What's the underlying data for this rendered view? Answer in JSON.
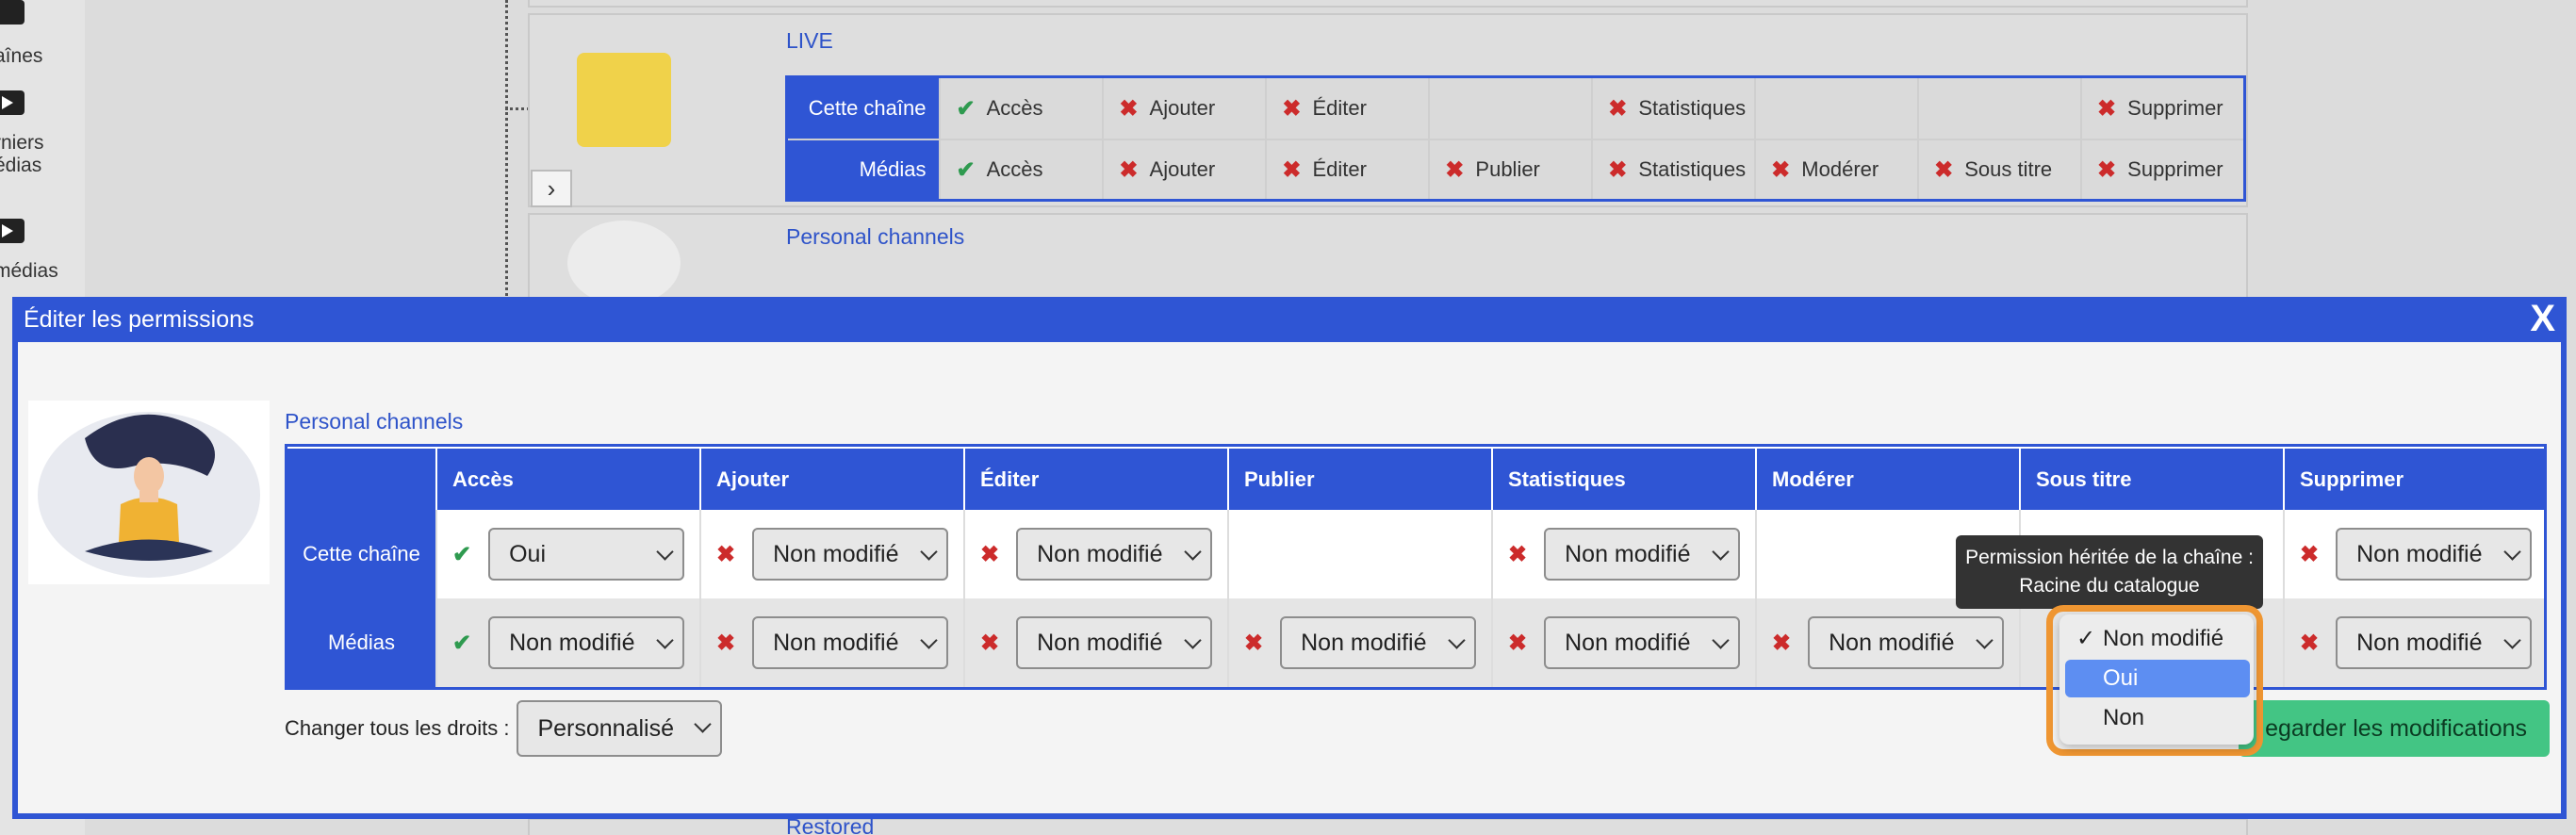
{
  "background": {
    "sidebar": [
      "aînes",
      "rniers\nédias",
      "médias"
    ],
    "rows": [
      {
        "name": "LIVE",
        "permissions": [
          {
            "label": "Cette chaîne",
            "cells": [
              {
                "mark": "check",
                "text": "Accès"
              },
              {
                "mark": "x",
                "text": "Ajouter"
              },
              {
                "mark": "x",
                "text": "Éditer"
              },
              {
                "mark": "",
                "text": ""
              },
              {
                "mark": "x",
                "text": "Statistiques"
              },
              {
                "mark": "",
                "text": ""
              },
              {
                "mark": "",
                "text": ""
              },
              {
                "mark": "x",
                "text": "Supprimer"
              }
            ]
          },
          {
            "label": "Médias",
            "cells": [
              {
                "mark": "check",
                "text": "Accès"
              },
              {
                "mark": "x",
                "text": "Ajouter"
              },
              {
                "mark": "x",
                "text": "Éditer"
              },
              {
                "mark": "x",
                "text": "Publier"
              },
              {
                "mark": "x",
                "text": "Statistiques"
              },
              {
                "mark": "x",
                "text": "Modérer"
              },
              {
                "mark": "x",
                "text": "Sous titre"
              },
              {
                "mark": "x",
                "text": "Supprimer"
              }
            ]
          }
        ]
      },
      {
        "name": "Personal channels"
      },
      {
        "name": "Restored"
      }
    ]
  },
  "modal": {
    "title": "Éditer les permissions",
    "close": "X",
    "channel_name": "Personal channels",
    "columns": [
      "Accès",
      "Ajouter",
      "Éditer",
      "Publier",
      "Statistiques",
      "Modérer",
      "Sous titre",
      "Supprimer"
    ],
    "rows": [
      {
        "label": "Cette chaîne",
        "cells": [
          {
            "mark": "check",
            "value": "Oui"
          },
          {
            "mark": "x",
            "value": "Non modifié"
          },
          {
            "mark": "x",
            "value": "Non modifié"
          },
          {
            "mark": "",
            "value": ""
          },
          {
            "mark": "x",
            "value": "Non modifié"
          },
          {
            "mark": "",
            "value": ""
          },
          {
            "mark": "",
            "value": ""
          },
          {
            "mark": "x",
            "value": "Non modifié"
          }
        ]
      },
      {
        "label": "Médias",
        "cells": [
          {
            "mark": "check",
            "value": "Non modifié"
          },
          {
            "mark": "x",
            "value": "Non modifié"
          },
          {
            "mark": "x",
            "value": "Non modifié"
          },
          {
            "mark": "x",
            "value": "Non modifié"
          },
          {
            "mark": "x",
            "value": "Non modifié"
          },
          {
            "mark": "x",
            "value": "Non modifié"
          },
          {
            "mark": "",
            "value": ""
          },
          {
            "mark": "x",
            "value": "Non modifié"
          }
        ]
      }
    ],
    "change_all_label": "Changer tous les droits :",
    "change_all_value": "Personnalisé",
    "save_label": "egarder les modifications",
    "tooltip_line1": "Permission héritée de la chaîne :",
    "tooltip_line2": "Racine du catalogue",
    "dropdown": {
      "options": [
        "Non modifié",
        "Oui",
        "Non"
      ],
      "checked": "Non modifié",
      "highlighted": "Oui"
    }
  },
  "colors": {
    "accent": "#2f55d4",
    "save": "#43c584",
    "focus_ring": "#ef9632",
    "check": "#2e9a4f",
    "cross": "#cc2b2b"
  }
}
